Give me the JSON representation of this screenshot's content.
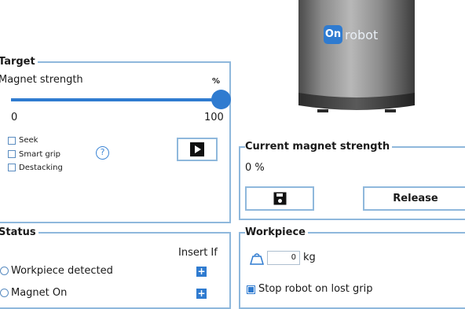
{
  "target": {
    "legend": "Target",
    "magnet_strength_label": "Magnet strength",
    "unit": "%",
    "slider_value_percent": 100,
    "slider_min": "0",
    "slider_max": "100",
    "checkboxes": [
      {
        "label": "Seek",
        "checked": false
      },
      {
        "label": "Smart grip",
        "checked": false
      },
      {
        "label": "Destacking",
        "checked": false
      }
    ],
    "help_symbol": "?",
    "play_icon": "play-icon"
  },
  "product": {
    "logo_mark": "On",
    "logo_text": "robot"
  },
  "current_strength": {
    "legend": "Current magnet strength",
    "value": "0 %",
    "save_icon": "save-icon",
    "release_label": "Release"
  },
  "status": {
    "legend": "Status",
    "column_header": "Insert If",
    "rows": [
      {
        "label": "Workpiece detected"
      },
      {
        "label": "Magnet On"
      }
    ],
    "plus_symbol": "+"
  },
  "workpiece": {
    "legend": "Workpiece",
    "weight_value": "0",
    "weight_unit": "kg",
    "stop_robot_label": "Stop robot on lost grip",
    "stop_robot_checked": true
  },
  "colors": {
    "panel_border": "#8fb8dc",
    "accent": "#2f7bd0"
  }
}
